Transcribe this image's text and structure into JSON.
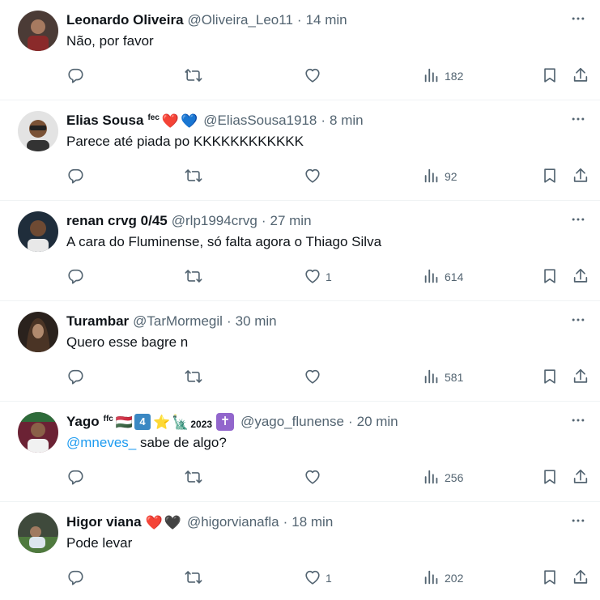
{
  "tweets": [
    {
      "name": "Leonardo Oliveira",
      "handle": "@Oliveira_Leo11",
      "time": "14 min",
      "text": "Não, por favor",
      "likes": "",
      "views": "182",
      "avatar_color": "#5a3a2e"
    },
    {
      "name": "Elias Sousa",
      "badge_text": "fec",
      "badges": [
        "❤️",
        "💙"
      ],
      "handle": "@EliasSousa1918",
      "time": "8 min",
      "text": "Parece até piada po KKKKKKKKKKKK",
      "likes": "",
      "views": "92",
      "avatar_color": "#c8c8c8"
    },
    {
      "name": "renan crvg 0/45",
      "handle": "@rlp1994crvg",
      "time": "27 min",
      "text": "A cara do Fluminense, só falta agora o Thiago Silva",
      "likes": "1",
      "views": "614",
      "avatar_color": "#2b3a4a"
    },
    {
      "name": "Turambar",
      "handle": "@TarMormegil",
      "time": "30 min",
      "text": "Quero esse bagre n",
      "likes": "",
      "views": "581",
      "avatar_color": "#3a2e26"
    },
    {
      "name": "Yago",
      "badge_text": "ffc",
      "badge_flag": "🇭🇺",
      "badge_num": "4",
      "badge_star": "⭐",
      "badge_statue": "🗽",
      "badge_year": "2023",
      "badge_cross": "✝",
      "handle": "@yago_flunense",
      "time": "20 min",
      "mention": "@mneves_",
      "text": " sabe de algo?",
      "likes": "",
      "views": "256",
      "avatar_color": "#7a2b3b"
    },
    {
      "name": "Higor viana",
      "badges": [
        "❤️",
        "🖤"
      ],
      "handle": "@higorvianafla",
      "time": "18 min",
      "text": "Pode levar",
      "likes": "1",
      "views": "202",
      "avatar_color": "#3d5a3a"
    }
  ],
  "separator": "·",
  "icons": {
    "more": "more-icon",
    "reply": "reply-icon",
    "retweet": "retweet-icon",
    "like": "heart-icon",
    "views": "views-icon",
    "bookmark": "bookmark-icon",
    "share": "share-icon"
  }
}
